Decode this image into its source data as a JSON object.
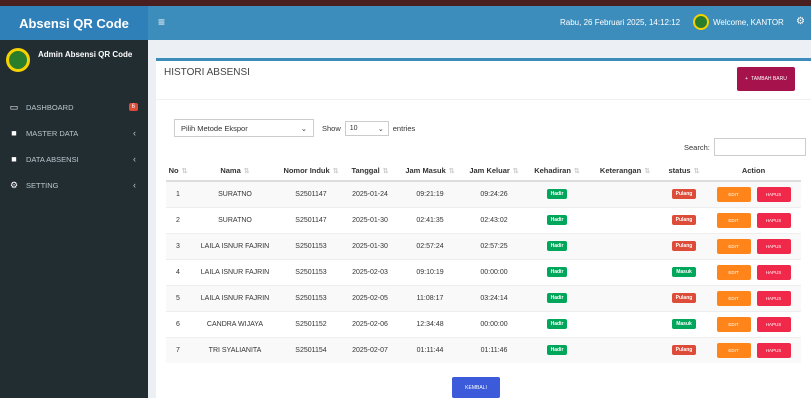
{
  "app": {
    "title": "Absensi QR Code"
  },
  "header": {
    "menu_icon": "hamburger-icon",
    "datetime": "Rabu, 26 Februari 2025, 14:12:12",
    "welcome": "Welcome, KANTOR"
  },
  "sidebar": {
    "user_name": "Admin Absensi QR Code",
    "items": [
      {
        "label": "DASHBOARD",
        "icon": "monitor-icon",
        "badge": "6"
      },
      {
        "label": "MASTER DATA",
        "icon": "folder-icon"
      },
      {
        "label": "DATA ABSENSI",
        "icon": "folder-icon"
      },
      {
        "label": "SETTING",
        "icon": "gears-icon"
      }
    ]
  },
  "main": {
    "title": "HISTORI ABSENSI",
    "add_button": "TAMBAH BARU",
    "export_select": "Pilih Metode Ekspor",
    "show_label": "Show",
    "entries_value": "10",
    "entries_label": "entries",
    "search_label": "Search:",
    "back_button": "KEMBALI",
    "edit_label": "EDIT",
    "delete_label": "HAPUS",
    "columns": [
      "No",
      "Nama",
      "Nomor Induk",
      "Tanggal",
      "Jam Masuk",
      "Jam Keluar",
      "Kehadiran",
      "Keterangan",
      "status",
      "Action"
    ],
    "rows": [
      {
        "no": "1",
        "nama": "SURATNO",
        "nomor_induk": "S2501147",
        "tanggal": "2025-01-24",
        "jam_masuk": "09:21:19",
        "jam_keluar": "09:24:26",
        "kehadiran": "Hadir",
        "keterangan": "",
        "status": "Pulang"
      },
      {
        "no": "2",
        "nama": "SURATNO",
        "nomor_induk": "S2501147",
        "tanggal": "2025-01-30",
        "jam_masuk": "02:41:35",
        "jam_keluar": "02:43:02",
        "kehadiran": "Hadir",
        "keterangan": "",
        "status": "Pulang"
      },
      {
        "no": "3",
        "nama": "LAILA ISNUR FAJRIN",
        "nomor_induk": "S2501153",
        "tanggal": "2025-01-30",
        "jam_masuk": "02:57:24",
        "jam_keluar": "02:57:25",
        "kehadiran": "Hadir",
        "keterangan": "",
        "status": "Pulang"
      },
      {
        "no": "4",
        "nama": "LAILA ISNUR FAJRIN",
        "nomor_induk": "S2501153",
        "tanggal": "2025-02-03",
        "jam_masuk": "09:10:19",
        "jam_keluar": "00:00:00",
        "kehadiran": "Hadir",
        "keterangan": "",
        "status": "Masuk"
      },
      {
        "no": "5",
        "nama": "LAILA ISNUR FAJRIN",
        "nomor_induk": "S2501153",
        "tanggal": "2025-02-05",
        "jam_masuk": "11:08:17",
        "jam_keluar": "03:24:14",
        "kehadiran": "Hadir",
        "keterangan": "",
        "status": "Pulang"
      },
      {
        "no": "6",
        "nama": "CANDRA WIJAYA",
        "nomor_induk": "S2501152",
        "tanggal": "2025-02-06",
        "jam_masuk": "12:34:48",
        "jam_keluar": "00:00:00",
        "kehadiran": "Hadir",
        "keterangan": "",
        "status": "Masuk"
      },
      {
        "no": "7",
        "nama": "TRI SYALIANITA",
        "nomor_induk": "S2501154",
        "tanggal": "2025-02-07",
        "jam_masuk": "01:11:44",
        "jam_keluar": "01:11:46",
        "kehadiran": "Hadir",
        "keterangan": "",
        "status": "Pulang"
      }
    ]
  },
  "colors": {
    "navbar": "#3c8dbc",
    "logo": "#2f7fb8",
    "sidebar": "#222d32",
    "hadir": "#00a65a",
    "pulang": "#dd4b39",
    "masuk": "#00a65a",
    "edit": "#ff851b",
    "delete": "#f0294a",
    "add": "#a5124c",
    "back": "#3b5bdb"
  }
}
